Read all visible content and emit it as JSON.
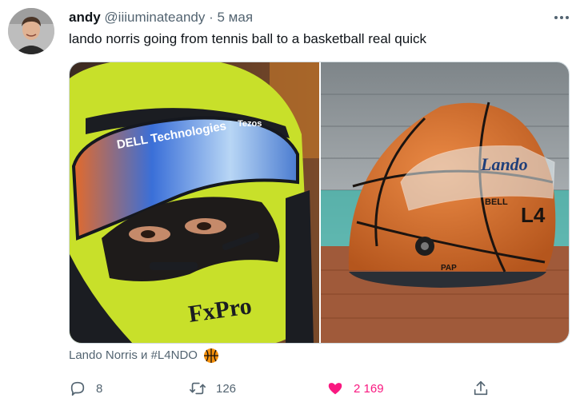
{
  "tweet": {
    "author_name": "andy",
    "handle": "@iiiuminateandy",
    "separator": "·",
    "date": "5 мая",
    "text": "lando norris going from tennis ball to a basketball real quick"
  },
  "media": {
    "left_helmet_text": [
      "DELL Technologies",
      "Tezos",
      "FxPro"
    ],
    "right_helmet_text": [
      "Lando",
      "BELL",
      "L4",
      "PAP"
    ]
  },
  "tags": {
    "text": "Lando Norris и #L4NDO"
  },
  "actions": {
    "reply_count": "8",
    "retweet_count": "126",
    "like_count": "2 169"
  },
  "colors": {
    "like": "#f91880",
    "secondary": "#536471",
    "helmet_yellow": "#c8e02a",
    "basketball": "#d8732e"
  },
  "icons": {
    "reply": "comment-icon",
    "retweet": "retweet-icon",
    "like": "heart-icon",
    "share": "share-icon",
    "more": "more-icon"
  }
}
